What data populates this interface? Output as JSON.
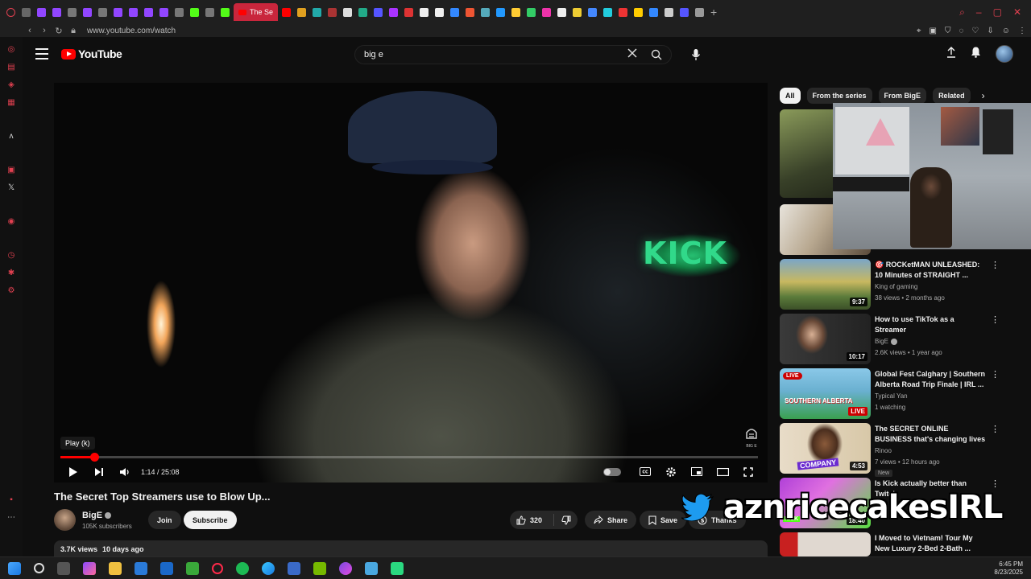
{
  "browser": {
    "active_tab_title": "The Se",
    "url": "www.youtube.com/watch"
  },
  "youtube": {
    "logo_text": "YouTube",
    "search_value": "big e",
    "search_placeholder": "Search"
  },
  "player": {
    "tooltip": "Play (k)",
    "time_current": "1:14",
    "time_total": "25:08",
    "time_display": "1:14 / 25:08",
    "progress_fraction": 0.049,
    "watermark": "BIG E",
    "scene_sign": "KICK"
  },
  "video": {
    "title": "The Secret Top Streamers use to Blow Up...",
    "channel_name": "BigE",
    "subscribers": "105K subscribers",
    "join_label": "Join",
    "subscribe_label": "Subscribe",
    "likes": "320",
    "share_label": "Share",
    "save_label": "Save",
    "thanks_label": "Thanks",
    "views": "3.7K views",
    "age": "10 days ago"
  },
  "chips": [
    {
      "label": "All",
      "active": true
    },
    {
      "label": "From the series",
      "active": false
    },
    {
      "label": "From BigE",
      "active": false
    },
    {
      "label": "Related",
      "active": false
    }
  ],
  "recommendations": [
    {
      "title": "",
      "channel": "",
      "meta": "",
      "duration": ""
    },
    {
      "title": "",
      "channel": "",
      "meta": "",
      "duration": ""
    },
    {
      "title": "🎯 ROCKetMAN UNLEASHED: 10 Minutes of STRAIGHT ...",
      "channel": "King of gaming",
      "meta": "38 views • 2 months ago",
      "duration": "9:37"
    },
    {
      "title": "How to use TikTok as a Streamer",
      "channel": "BigE",
      "meta": "2.6K views • 1 year ago",
      "duration": "10:17"
    },
    {
      "title": "Global Fest Calghary | Southern Alberta Road Trip Finale | IRL ...",
      "channel": "Typical Yan",
      "meta": "1 watching",
      "duration": "LIVE",
      "live_tag": "LIVE",
      "thumb_text": "SOUTHERN ALBERTA"
    },
    {
      "title": "The SECRET ONLINE BUSINESS that's changing lives quietly ...",
      "channel": "Rinoo",
      "meta": "7 views • 12 hours ago",
      "duration": "4:53",
      "badge": "New",
      "thumb_text": "COMPANY"
    },
    {
      "title": "Is Kick actually better than Twitch",
      "channel": "",
      "meta": "",
      "duration": "18:40",
      "thumb_text": "KICK"
    },
    {
      "title": "I Moved to Vietnam! Tour My New Luxury 2-Bed 2-Bath ...",
      "channel": "",
      "meta": "",
      "duration": ""
    }
  ],
  "overlay": {
    "streamer_name": "aznricecakesIRL"
  },
  "taskbar": {
    "time": "6:45 PM",
    "date": "8/23/2025"
  },
  "colors": {
    "accent": "#ff0000",
    "background": "#0f0f0f",
    "chip_bg": "#272727",
    "kick_green": "#31d98a"
  }
}
